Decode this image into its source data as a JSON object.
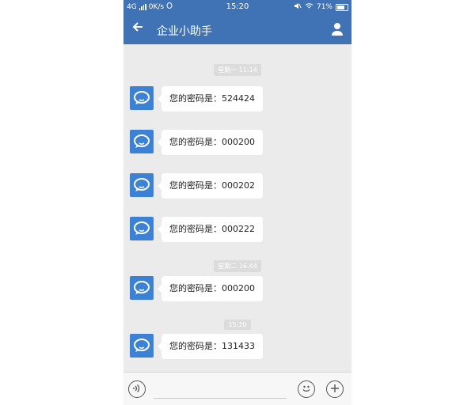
{
  "status_bar": {
    "network": "4G",
    "speed": "0K/s",
    "time": "15:20",
    "battery": "71%"
  },
  "header": {
    "back_icon": "arrow-left-icon",
    "title": "企业小助手",
    "user_icon": "user-icon"
  },
  "timestamps": [
    "星期一 11:14",
    "星期二 16:44",
    "15:20"
  ],
  "messages": [
    {
      "text": "您的密码是：524424"
    },
    {
      "text": "您的密码是：000200"
    },
    {
      "text": "您的密码是：000202"
    },
    {
      "text": "您的密码是：000222"
    },
    {
      "text": "您的密码是：000200"
    },
    {
      "text": "您的密码是：131433"
    }
  ],
  "input_bar": {
    "voice_icon": "voice-icon",
    "emoji_icon": "emoji-icon",
    "plus_icon": "plus-icon"
  },
  "colors": {
    "header": "#3f73b5",
    "avatar": "#3b82d6",
    "chat_bg": "#ebebeb"
  }
}
